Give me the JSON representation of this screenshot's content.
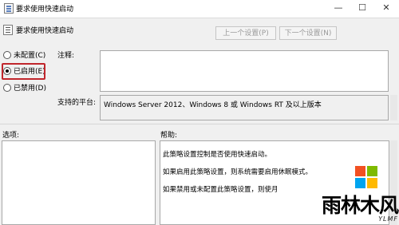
{
  "window": {
    "title": "要求使用快速启动",
    "minimize_glyph": "—",
    "maximize_glyph": "☐",
    "close_glyph": "✕"
  },
  "header": {
    "policy_name": "要求使用快速启动",
    "prev_button": "上一个设置(P)",
    "next_button": "下一个设置(N)"
  },
  "state_options": [
    {
      "label": "未配置(C)",
      "selected": false
    },
    {
      "label": "已启用(E)",
      "selected": true
    },
    {
      "label": "已禁用(D)",
      "selected": false
    }
  ],
  "comment": {
    "label": "注释:",
    "value": ""
  },
  "supported_on": {
    "label": "支持的平台:",
    "value": "Windows Server 2012、Windows 8 或 Windows RT 及以上版本"
  },
  "options_section": {
    "label": "选项:"
  },
  "help_section": {
    "label": "帮助:",
    "paragraphs": [
      "此策略设置控制是否使用快速启动。",
      "如果启用此策略设置，则系统需要启用休眠模式。",
      "如果禁用或未配置此策略设置，则使月"
    ]
  },
  "watermark": {
    "brand": "雨林木风",
    "sub": "YLMF",
    "logo_colors": [
      "#f25022",
      "#7fba00",
      "#00a4ef",
      "#ffb900"
    ]
  },
  "colors": {
    "highlight": "#c0262c"
  }
}
